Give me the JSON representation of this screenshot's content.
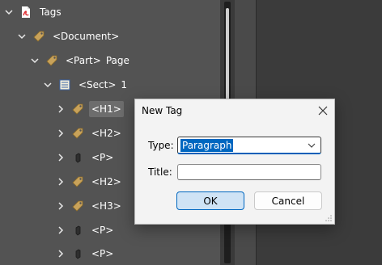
{
  "tree": {
    "rows": [
      {
        "label": "Tags",
        "label2": "",
        "icon": "pdf-icon",
        "chevron": "down"
      },
      {
        "label": "<Document>",
        "label2": "",
        "icon": "tag-icon",
        "chevron": "down"
      },
      {
        "label": "<Part>",
        "label2": "Page",
        "icon": "tag-icon",
        "chevron": "down"
      },
      {
        "label": "<Sect>",
        "label2": "1",
        "icon": "section-icon",
        "chevron": "down"
      },
      {
        "label": "<H1>",
        "label2": "",
        "icon": "tag-icon",
        "chevron": "right",
        "highlighted": true
      },
      {
        "label": "<H2>",
        "label2": "",
        "icon": "tag-icon",
        "chevron": "right"
      },
      {
        "label": "<P>",
        "label2": "",
        "icon": "tag-small-icon",
        "chevron": "right"
      },
      {
        "label": "<H2>",
        "label2": "",
        "icon": "tag-icon",
        "chevron": "right"
      },
      {
        "label": "<H3>",
        "label2": "",
        "icon": "tag-icon",
        "chevron": "right"
      },
      {
        "label": "<P>",
        "label2": "",
        "icon": "tag-small-icon",
        "chevron": "right"
      },
      {
        "label": "<P>",
        "label2": "",
        "icon": "tag-small-icon",
        "chevron": "right"
      }
    ]
  },
  "dialog": {
    "title": "New Tag",
    "type_label": "Type:",
    "type_value": "Paragraph",
    "title_label": "Title:",
    "title_value": "",
    "ok_label": "OK",
    "cancel_label": "Cancel"
  },
  "colors": {
    "panel_bg": "#535353",
    "accent": "#0067c0",
    "tag_icon": "#c8a25a"
  }
}
